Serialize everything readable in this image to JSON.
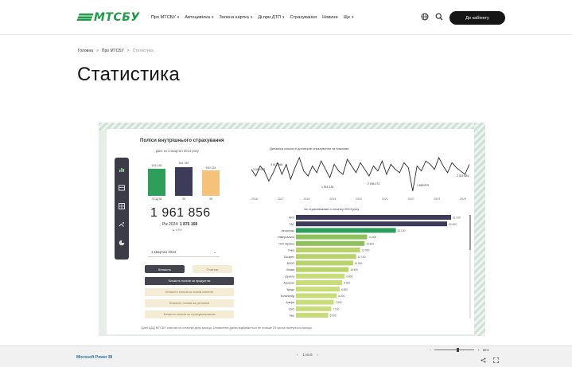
{
  "header": {
    "logo_text": "МТСБУ",
    "nav": [
      {
        "label": "Про МТСБУ",
        "caret": "▾"
      },
      {
        "label": "Автоцивілка",
        "caret": "▾"
      },
      {
        "label": "Зелена картка",
        "caret": "▾"
      },
      {
        "label": "Ді при ДТП",
        "caret": "▾"
      },
      {
        "label": "Страхування",
        "caret": ""
      },
      {
        "label": "Новини",
        "caret": ""
      },
      {
        "label": "Ще",
        "caret": "▾"
      }
    ],
    "icons": [
      "globe-icon",
      "search-icon",
      "user-icon"
    ],
    "cta_label": "До кабінету"
  },
  "breadcrumb": {
    "items": [
      "Головна",
      "Про МТСБУ",
      "Статистика"
    ],
    "separator": ">"
  },
  "page_title": "Статистика",
  "report": {
    "kpi": {
      "title": "Поліси внутрішнього страхування",
      "subtitle": "Дані за 1 квартал 2024 року",
      "bars": [
        {
          "top_label": "626 148",
          "caption": "ОСЦПВ",
          "value": 626148,
          "color": "#2e9e5b"
        },
        {
          "top_label": "661 789",
          "caption": "ЗК",
          "value": 661789,
          "color": "#3d3b5a"
        },
        {
          "top_label": "590 134",
          "caption": "ЗК",
          "value": 590134,
          "color": "#f4c27a"
        }
      ],
      "total": "1 961 856",
      "compare_label": "Рік 2024:",
      "compare_value": "1 876 168",
      "delta": "▲ 4.6%"
    },
    "period_dropdown": {
      "value": "1 квартал 2024",
      "caret": "⌄"
    },
    "buttons": {
      "primary": "Кількість",
      "secondary": "Платежі",
      "wide": [
        {
          "label": "Кількість полісів за продуктом",
          "style": "dark"
        },
        {
          "label": "Кількість полісів за типом клієнтів",
          "style": "light"
        },
        {
          "label": "Кількість полісів за регіоном",
          "style": "light"
        },
        {
          "label": "Кількість полісів за страхувальником",
          "style": "light"
        }
      ]
    },
    "footnote": "Дані ЦБД МТСБУ станом на останній день місяця. Оновлення даних відбувається не пізніше 20 числа наступного місяця.",
    "side_icons": [
      "chart-icon",
      "table-icon",
      "grid-icon",
      "filter-icon",
      "pie-icon"
    ]
  },
  "chart_data": [
    {
      "type": "line",
      "title": "Динаміка кількості договорів страхування за тижнями",
      "x": [
        "2016",
        "2017",
        "2018",
        "2019",
        "2020",
        "2021",
        "2022",
        "2023",
        "2024"
      ],
      "values": [
        31,
        27,
        33,
        30,
        24,
        29,
        35,
        28,
        34,
        25,
        32,
        38,
        30,
        27,
        33,
        29,
        36,
        31,
        26,
        34,
        30,
        28,
        37,
        33,
        29,
        35,
        31,
        27,
        33,
        30,
        36,
        28,
        34,
        31,
        29,
        35,
        32,
        18,
        33,
        30,
        36,
        34,
        31,
        38,
        33,
        29,
        35,
        32,
        30,
        28,
        34
      ],
      "annotations": [
        "3 040 045",
        "3 012 568",
        "1 914 126",
        "2 186 474",
        "1 869 879",
        "2 024 484"
      ],
      "grid": false
    },
    {
      "type": "bar",
      "orientation": "horizontal",
      "title": "За страховиками з початку 2024 року",
      "categories": [
        "ARX",
        "ТАС",
        "Інгосстрах",
        "Універсальна",
        "ПЗУ Україна",
        "Уніка",
        "Експрес",
        "ВУСО",
        "Княжа",
        "Оранта",
        "Арсенал",
        "Кредо",
        "Колоннейд",
        "Альфа",
        "USG",
        "Інші"
      ],
      "values": [
        31200,
        30400,
        20100,
        14300,
        13800,
        12900,
        12100,
        11500,
        10600,
        9800,
        9300,
        8800,
        8200,
        7600,
        7100,
        6500
      ],
      "colors": [
        "#3d3b5a",
        "#3d3b5a",
        "#2e9e5b",
        "#8fc15a",
        "#8fc15a",
        "#b7d36a",
        "#b7d36a",
        "#b7d36a",
        "#b7d36a",
        "#c8dc7a",
        "#c8dc7a",
        "#c8dc7a",
        "#c8dc7a",
        "#c8dc7a",
        "#c8dc7a",
        "#c8dc7a"
      ],
      "xlim": [
        0,
        32000
      ]
    }
  ],
  "footer": {
    "powerbi_link": "Microsoft Power BI",
    "pager_prev": "‹",
    "pager_label": "1 из 5",
    "pager_next": "›",
    "zoom_minus": "−",
    "zoom_plus": "+",
    "zoom_value": "85%"
  }
}
